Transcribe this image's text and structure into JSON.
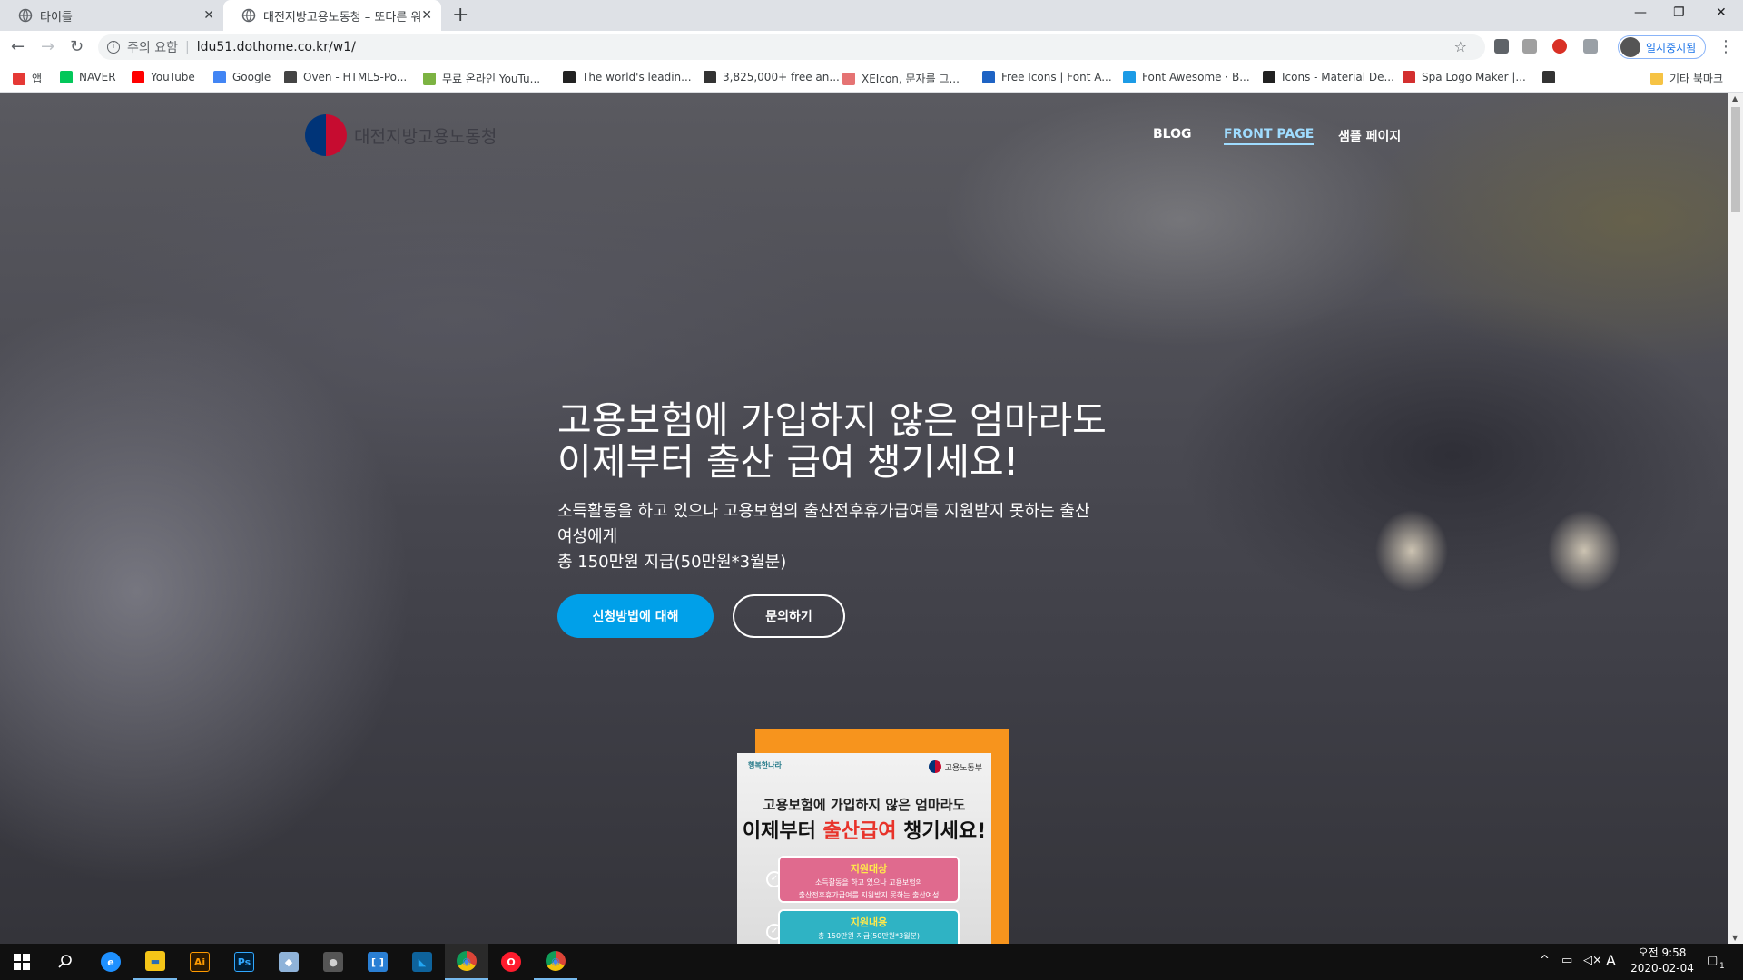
{
  "browser": {
    "tabs": [
      {
        "title": "타이틀"
      },
      {
        "title": "대전지방고용노동청 – 또다른 워"
      }
    ],
    "address": {
      "warning": "주의 요함",
      "url": "ldu51.dothome.co.kr/w1/"
    },
    "profile_label": "일시중지됨",
    "bookmarks": [
      {
        "label": "앱",
        "color": "#e53935"
      },
      {
        "label": "NAVER",
        "color": "#03c75a"
      },
      {
        "label": "YouTube",
        "color": "#ff0000"
      },
      {
        "label": "Google",
        "color": "#4285f4"
      },
      {
        "label": "Oven - HTML5-Po...",
        "color": "#444444"
      },
      {
        "label": "무료 온라인 YouTu...",
        "color": "#7cb342"
      },
      {
        "label": "The world's leadin...",
        "color": "#222222"
      },
      {
        "label": "3,825,000+ free an...",
        "color": "#333333"
      },
      {
        "label": "XEIcon, 문자를 그...",
        "color": "#e57373"
      },
      {
        "label": "Free Icons | Font A...",
        "color": "#1e63c4"
      },
      {
        "label": "Font Awesome · B...",
        "color": "#1c9be6"
      },
      {
        "label": "Icons - Material De...",
        "color": "#212121"
      },
      {
        "label": "Spa Logo Maker |...",
        "color": "#d32f2f"
      },
      {
        "label": "",
        "color": "#333333"
      }
    ],
    "other_bookmarks": "기타 북마크"
  },
  "site": {
    "logo_text": "대전지방고용노동청",
    "nav": [
      {
        "label": "BLOG"
      },
      {
        "label": "FRONT PAGE"
      },
      {
        "label": "샘플 페이지"
      }
    ],
    "hero": {
      "title_line1": "고용보험에 가입하지 않은 엄마라도",
      "title_line2": "이제부터 출산 급여 챙기세요!",
      "desc_line1": "소득활동을 하고 있으나 고용보험의 출산전후휴가급여를 지원받지 못하는 출산",
      "desc_line2": "여성에게",
      "desc_line3": "총 150만원 지급(50만원*3월분)",
      "btn_apply": "신청방법에 대해",
      "btn_contact": "문의하기"
    },
    "poster": {
      "brand_left": "행복한나라",
      "brand_right": "고용노동부",
      "headline1": "고용보험에 가입하지 않은 엄마라도",
      "headline2_a": "이제부터 ",
      "headline2_red": "출산급여",
      "headline2_b": " 챙기세요!",
      "box1_title": "지원대상",
      "box1_line1": "소득활동을 하고 있으나 고용보험의",
      "box1_line2": "출산전후휴가급여를 지원받지 못하는 출산여성",
      "box2_title": "지원내용",
      "box2_line1": "총 150만원 지급(50만원*3월분)"
    }
  },
  "taskbar": {
    "apps": [
      {
        "name": "Edge",
        "glyph": "e",
        "color": "#1e90ff"
      },
      {
        "name": "Explorer",
        "glyph": "▬",
        "color": "#f5c518"
      },
      {
        "name": "Illustrator",
        "glyph": "Ai",
        "color": "#ff9a00"
      },
      {
        "name": "Photoshop",
        "glyph": "Ps",
        "color": "#31a8ff"
      },
      {
        "name": "Notes",
        "glyph": "◆",
        "color": "#8fb3d9"
      },
      {
        "name": "Cloud",
        "glyph": "●",
        "color": "#d0d0d0"
      },
      {
        "name": "Brackets",
        "glyph": "[ ]",
        "color": "#2a7fd4"
      },
      {
        "name": "VS Code",
        "glyph": "◣",
        "color": "#22a6f2"
      },
      {
        "name": "Chrome",
        "glyph": "◉",
        "color": "#f4c20d"
      },
      {
        "name": "Opera",
        "glyph": "O",
        "color": "#ff1b2d"
      },
      {
        "name": "Chrome",
        "glyph": "◉",
        "color": "#f4c20d"
      }
    ],
    "time": "오전 9:58",
    "date": "2020-02-04",
    "ime": "A",
    "notifications": "1"
  }
}
